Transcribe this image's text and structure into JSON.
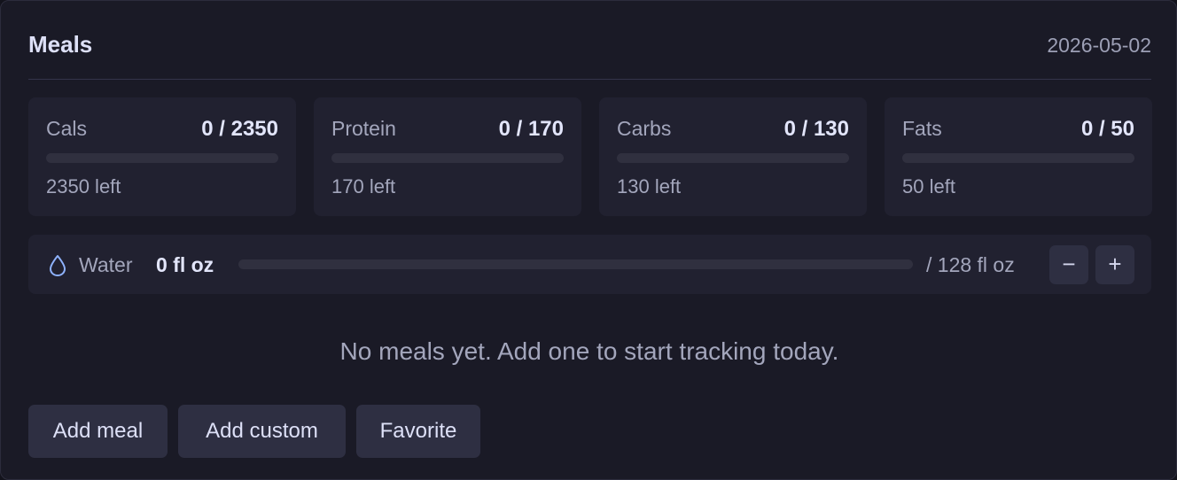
{
  "header": {
    "title": "Meals",
    "date": "2026-05-02"
  },
  "macros": [
    {
      "label": "Cals",
      "value": "0 / 2350",
      "left": "2350 left",
      "progress": 0
    },
    {
      "label": "Protein",
      "value": "0 / 170",
      "left": "170 left",
      "progress": 0
    },
    {
      "label": "Carbs",
      "value": "0 / 130",
      "left": "130 left",
      "progress": 0
    },
    {
      "label": "Fats",
      "value": "0 / 50",
      "left": "50 left",
      "progress": 0
    }
  ],
  "water": {
    "icon": "water-drop-icon",
    "label": "Water",
    "amount": "0 fl oz",
    "target": "/ 128 fl oz",
    "progress": 0,
    "decrement_label": "−",
    "increment_label": "+"
  },
  "empty_state": "No meals yet. Add one to start tracking today.",
  "actions": {
    "add_meal": "Add meal",
    "add_custom": "Add custom",
    "favorite": "Favorite"
  },
  "colors": {
    "background": "#1a1a26",
    "tile": "#212130",
    "button": "#2e2f42",
    "accent": "#7f8cff"
  }
}
